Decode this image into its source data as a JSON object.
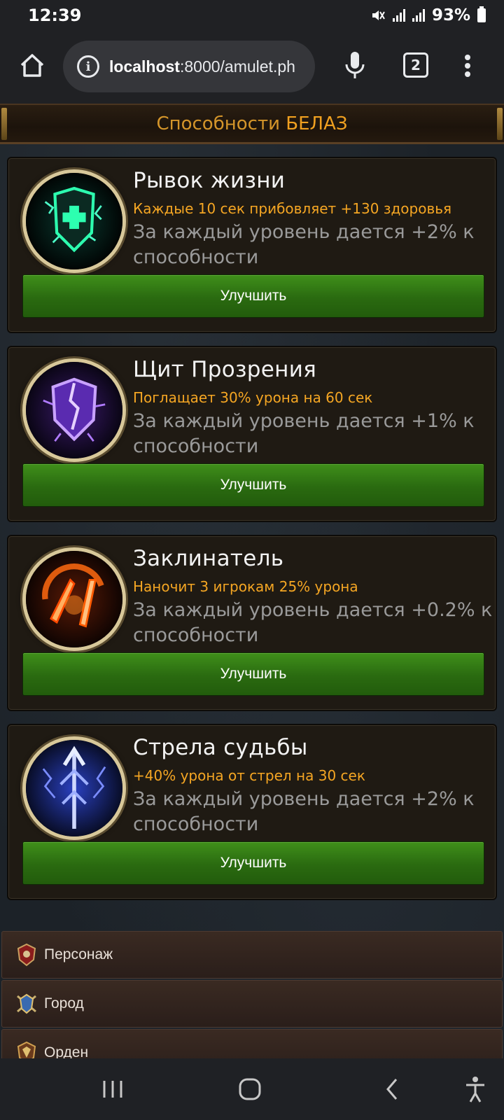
{
  "status_bar": {
    "time": "12:39",
    "battery": "93%"
  },
  "browser": {
    "url_host": "localhost",
    "url_rest": ":8000/amulet.ph",
    "tab_count": "2"
  },
  "header": {
    "title_prefix": "Способности",
    "title_name": "БЕЛАЗ"
  },
  "abilities": [
    {
      "title": "Рывок жизни",
      "effect": "Каждые 10 сек прибовляет +130 здоровья",
      "desc": "За каждый уровень дается +2% к способности",
      "button": "Улучшить",
      "icon": "healing-shield-icon"
    },
    {
      "title": "Щит Прозрения",
      "effect": "Поглащает 30% урона на 60 сек",
      "desc": "За каждый уровень дается +1% к способности",
      "button": "Улучшить",
      "icon": "purple-shield-icon"
    },
    {
      "title": "Заклинатель",
      "effect": "Наночит 3 игрокам 25% урона",
      "desc": "За каждый уровень дается +0.2% к способности",
      "button": "Улучшить",
      "icon": "fire-swords-icon"
    },
    {
      "title": "Стрела судьбы",
      "effect": "+40% урона от стрел на 30 сек",
      "desc": "За каждый уровень дается +2% к способности",
      "button": "Улучшить",
      "icon": "lightning-arrow-icon"
    }
  ],
  "nav": [
    {
      "label": "Персонаж",
      "icon": "character-crest-icon"
    },
    {
      "label": "Город",
      "icon": "city-crest-icon"
    },
    {
      "label": "Орден",
      "icon": "order-crest-icon"
    }
  ]
}
